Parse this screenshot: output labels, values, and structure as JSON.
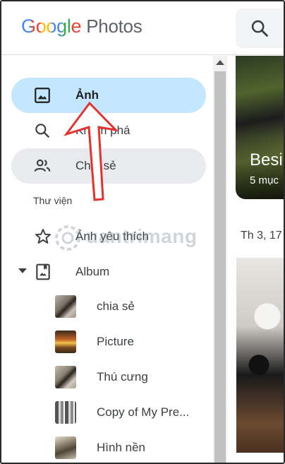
{
  "app": {
    "logo_google": "Google",
    "logo_product": "Photos"
  },
  "nav": {
    "photos": "Ảnh",
    "explore": "Khám phá",
    "sharing": "Chia sẻ"
  },
  "library": {
    "section_label": "Thư viện",
    "favorites": "Ảnh yêu thích",
    "album": "Album",
    "albums": [
      {
        "label": "chia sẻ"
      },
      {
        "label": "Picture"
      },
      {
        "label": "Thú cưng"
      },
      {
        "label": "Copy of My Pre..."
      },
      {
        "label": "Hình nền"
      }
    ]
  },
  "content": {
    "card_title": "Besi",
    "card_count": "5 mục",
    "date_header": "Th 3, 17"
  },
  "watermark": "uantrimang",
  "colors": {
    "active_nav": "#c2e7ff",
    "hover_nav": "#e8eaed",
    "annotation_red": "#e5322d"
  }
}
